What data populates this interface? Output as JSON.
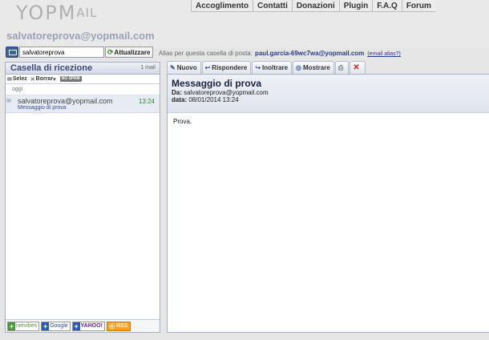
{
  "logo": {
    "text": "YOPM",
    "text_small": "AIL"
  },
  "nav": [
    "Accoglimento",
    "Contatti",
    "Donazioni",
    "Plugin",
    "F.A.Q",
    "Forum"
  ],
  "mailbox_email": "salvatoreprova@yopmail.com",
  "search": {
    "value": "salvatoreprova",
    "refresh_label": "Attualizzare"
  },
  "alias": {
    "label": "Alias per questa casella di posta:",
    "address": "paul.garcia-69wc7wa@yopmail.com",
    "link": "(email alias?)"
  },
  "inbox": {
    "title": "Casella di ricezione",
    "count": "1 mail",
    "tools": {
      "select": "Selez",
      "delete": "Borrar",
      "nospam": "NO SPAM"
    },
    "day_group": "oggi",
    "messages": [
      {
        "from": "salvatoreprova@yopmail.com",
        "time": "13:24",
        "subject": "Messaggio di prova"
      }
    ]
  },
  "footer": {
    "netvibes": "netvibes",
    "google": "Google",
    "yahoo": "YAHOO!",
    "rss": "RSS"
  },
  "toolbar": {
    "new": "Nuovo",
    "reply": "Rispondere",
    "forward": "Inoltrare",
    "show": "Mostrare"
  },
  "message": {
    "title": "Messaggio di prova",
    "from_label": "Da:",
    "from_value": "salvatoreprova@yopmail.com",
    "date_label": "data:",
    "date_value": "08/01/2014 13:24",
    "body": "Prova."
  },
  "colors": {
    "panel_border": "#a7afc4",
    "title_blue": "#3b4a78",
    "time_green": "#2c8a2c",
    "link_blue": "#2a3a8a"
  },
  "icons": [
    "mail-icon",
    "refresh-icon",
    "envelope-icon",
    "print-icon",
    "delete-icon"
  ]
}
